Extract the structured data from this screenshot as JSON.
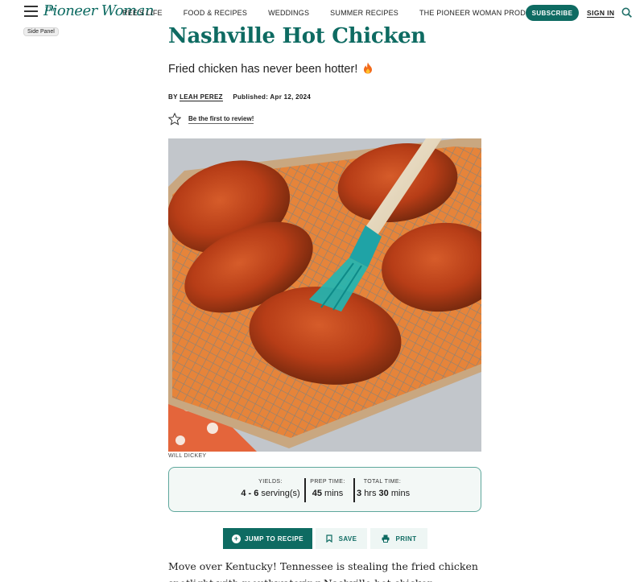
{
  "header": {
    "logo_top": "The",
    "logo_main": "Pioneer Woman",
    "nav": [
      "REE'S LIFE",
      "FOOD & RECIPES",
      "WEDDINGS",
      "SUMMER RECIPES",
      "THE PIONEER WOMAN PRODUCTS"
    ],
    "subscribe_label": "SUBSCRIBE",
    "signin_label": "SIGN IN"
  },
  "tooltip": "Side Panel",
  "article": {
    "title": "Nashville Hot Chicken",
    "subtitle": "Fried chicken has never been hotter!",
    "by_label": "BY",
    "author": "LEAH PEREZ",
    "published": "Published: Apr 12, 2024",
    "review_link": "Be the first to review!",
    "photo_credit": "WILL DICKEY"
  },
  "recipe_info": {
    "yields_label": "YIELDS:",
    "yields_value": "4 - 6",
    "yields_unit": "serving(s)",
    "prep_label": "PREP TIME:",
    "prep_value": "45",
    "prep_unit": "mins",
    "total_label": "TOTAL TIME:",
    "total_hours": "3",
    "total_hours_unit": "hrs",
    "total_mins": "30",
    "total_mins_unit": "mins"
  },
  "actions": {
    "jump_label": "JUMP TO RECIPE",
    "save_label": "SAVE",
    "print_label": "PRINT"
  },
  "body": "Move over Kentucky! Tennessee is stealing the fried chicken spotlight with mouthwatering Nashville hot chicken, guaranteed to set tongues",
  "colors": {
    "brand": "#0e6b62",
    "info_border": "#5ea79c"
  },
  "icons": [
    "menu-icon",
    "search-icon",
    "flame-icon",
    "star-icon",
    "plus-circle-icon",
    "bookmark-icon",
    "printer-icon"
  ]
}
